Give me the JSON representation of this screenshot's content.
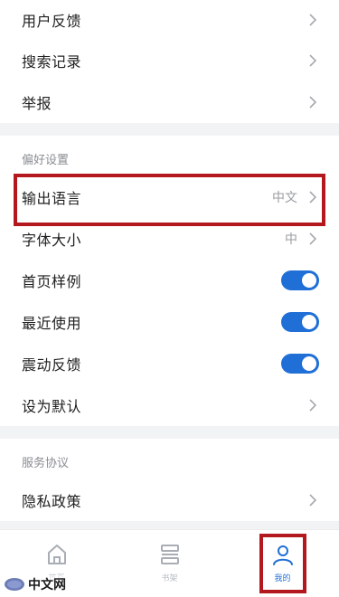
{
  "group1": {
    "items": [
      {
        "label": "用户反馈"
      },
      {
        "label": "搜索记录"
      },
      {
        "label": "举报"
      }
    ]
  },
  "preferences": {
    "title": "偏好设置",
    "output_language": {
      "label": "输出语言",
      "value": "中文"
    },
    "font_size": {
      "label": "字体大小",
      "value": "中"
    },
    "home_sample": {
      "label": "首页样例",
      "enabled": true
    },
    "recent_use": {
      "label": "最近使用",
      "enabled": true
    },
    "vibration": {
      "label": "震动反馈",
      "enabled": true
    },
    "set_default": {
      "label": "设为默认"
    }
  },
  "service": {
    "title": "服务协议",
    "privacy": {
      "label": "隐私政策"
    }
  },
  "tabbar": {
    "home": {
      "label": "首页",
      "icon": "home-icon"
    },
    "bookshelf": {
      "label": "书架",
      "icon": "bookshelf-icon"
    },
    "mine": {
      "label": "我的",
      "icon": "user-icon",
      "active": true
    }
  },
  "watermark": {
    "text": "中文网"
  },
  "colors": {
    "accent": "#1f6fd6",
    "highlight": "#b3181e",
    "background": "#f2f3f5"
  }
}
